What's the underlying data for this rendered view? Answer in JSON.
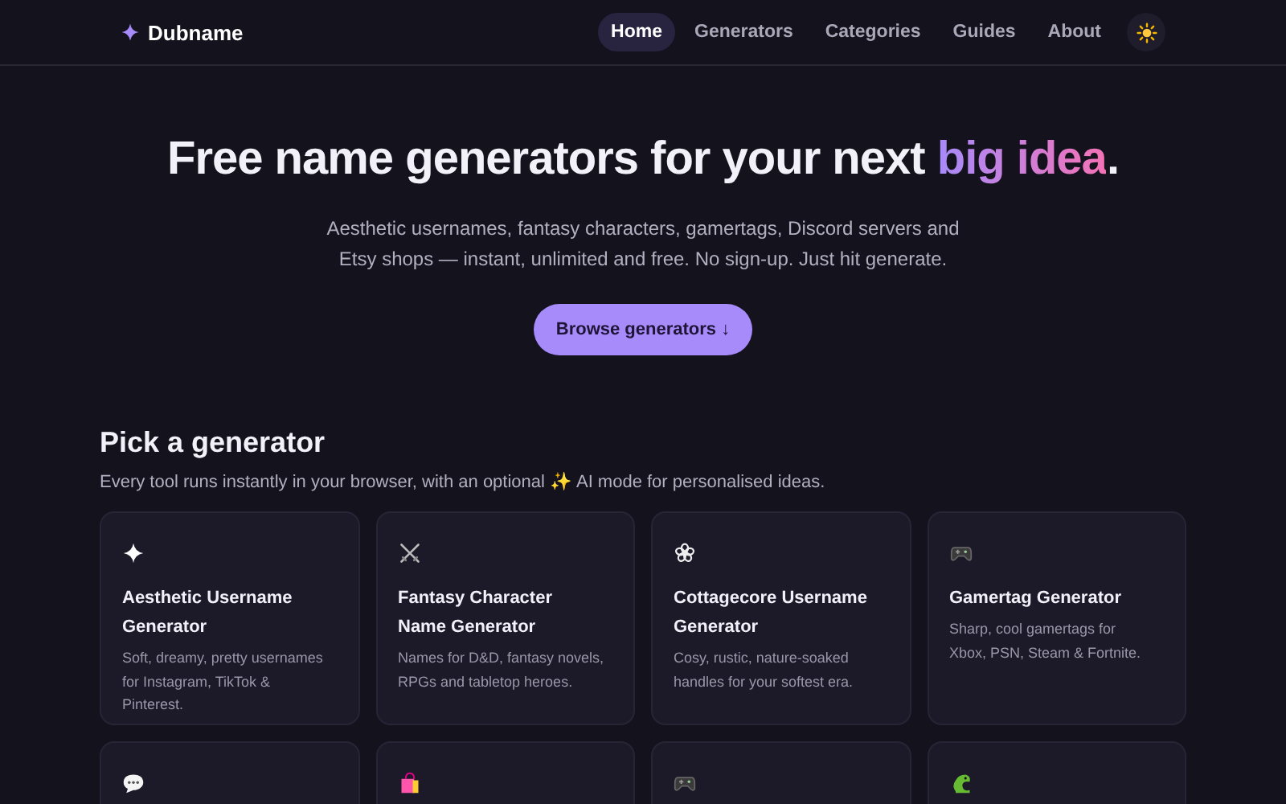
{
  "nav": {
    "brand": "Dubname",
    "links": [
      {
        "label": "Home",
        "selected": true
      },
      {
        "label": "Generators",
        "selected": false
      },
      {
        "label": "Categories",
        "selected": false
      },
      {
        "label": "Guides",
        "selected": false
      },
      {
        "label": "About",
        "selected": false
      }
    ]
  },
  "hero": {
    "title": "Free name generators for your next ",
    "title_highlight": "big idea",
    "title_end": ".",
    "subtitle": "Aesthetic usernames, fantasy characters, gamertags, Discord servers and Etsy shops — instant, unlimited and free. No sign-up. Just hit generate.",
    "button": "Browse generators ↓"
  },
  "section": {
    "title": "Pick a generator",
    "subtitle": "Every tool runs instantly in your browser, with an optional ✨ AI mode for personalised ideas."
  },
  "cards": [
    {
      "kind": "sparkle",
      "title": "Aesthetic Username Generator",
      "description": "Soft, dreamy, pretty usernames for Instagram, TikTok & Pinterest."
    },
    {
      "kind": "swords",
      "title": "Fantasy Character Name Generator",
      "description": "Names for D&D, fantasy novels, RPGs and tabletop heroes."
    },
    {
      "kind": "flower",
      "title": "Cottagecore Username Generator",
      "description": "Cosy, rustic, nature-soaked handles for your softest era."
    },
    {
      "kind": "gamepad",
      "title": "Gamertag Generator",
      "description": "Sharp, cool gamertags for Xbox, PSN, Steam & Fortnite."
    },
    {
      "kind": "speech"
    },
    {
      "kind": "bag"
    },
    {
      "kind": "gamepad"
    },
    {
      "kind": "dragon"
    }
  ]
}
